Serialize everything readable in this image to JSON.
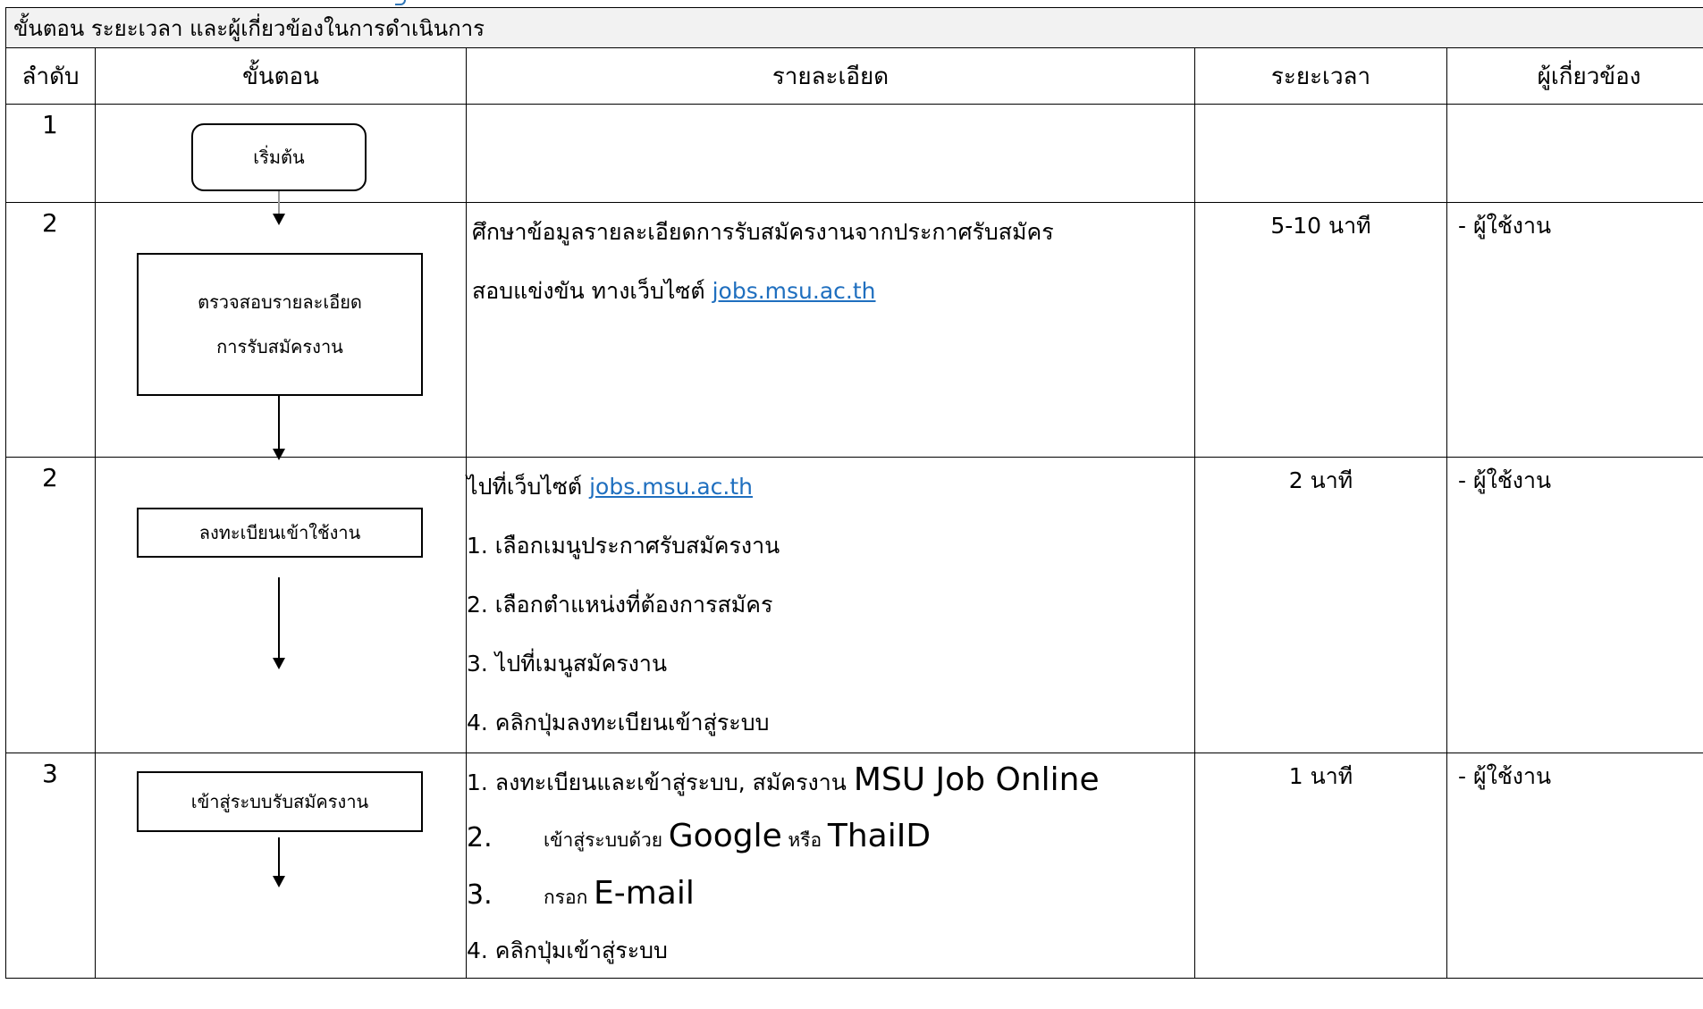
{
  "header": {
    "title": "ขั้นตอน ระยะเวลา และผู้เกี่ยวข้องในการดำเนินการ"
  },
  "columns": {
    "order": "ลำดับ",
    "step": "ขั้นตอน",
    "detail": "รายละเอียด",
    "duration": "ระยะเวลา",
    "person": "ผู้เกี่ยวข้อง"
  },
  "rows": [
    {
      "num": "1",
      "box": [
        "เริ่มต้น"
      ],
      "detail": [],
      "duration": "",
      "person": ""
    },
    {
      "num": "2",
      "box": [
        "ตรวจสอบรายละเอียด",
        "การรับสมัครงาน"
      ],
      "detail_text1": "ศึกษาข้อมูลรายละเอียดการรับสมัครงานจากประกาศรับสมัคร",
      "detail_text2": "สอบแข่งขัน ทางเว็บไซต์ ",
      "link": "jobs.msu.ac.th",
      "duration": "5-10 นาที",
      "person": "- ผู้ใช้งาน"
    },
    {
      "num": "2",
      "box": [
        "ลงทะเบียนเข้าใช้งาน"
      ],
      "detail_intro": "ไปที่เว็บไซต์ ",
      "link": "jobs.msu.ac.th",
      "items": [
        "1.  เลือกเมนูประกาศรับสมัครงาน",
        "2.  เลือกตำแหน่งที่ต้องการสมัคร",
        "3.  ไปที่เมนูสมัครงาน",
        "4.  คลิกปุ่มลงทะเบียนเข้าสู่ระบบ"
      ],
      "duration": "2 นาที",
      "person": "- ผู้ใช้งาน"
    },
    {
      "num": "3",
      "box": [
        "เข้าสู่ระบบรับสมัครงาน"
      ],
      "item1_a": "1.  ลงทะเบียนและเข้าสู่ระบบ, สมัครงาน ",
      "item1_b": "MSU   Job   Online",
      "item2_n": "2.",
      "item2_a": "เข้าสู่ระบบด้วย ",
      "item2_b": "Google",
      "item2_c": "  หรือ ",
      "item2_d": "ThaiID",
      "item3_n": "3.",
      "item3_a": "กรอก ",
      "item3_b": "E-mail",
      "item4": "4.  คลิกปุ่มเข้าสู่ระบบ",
      "duration": "1 นาที",
      "person": "- ผู้ใช้งาน"
    }
  ]
}
